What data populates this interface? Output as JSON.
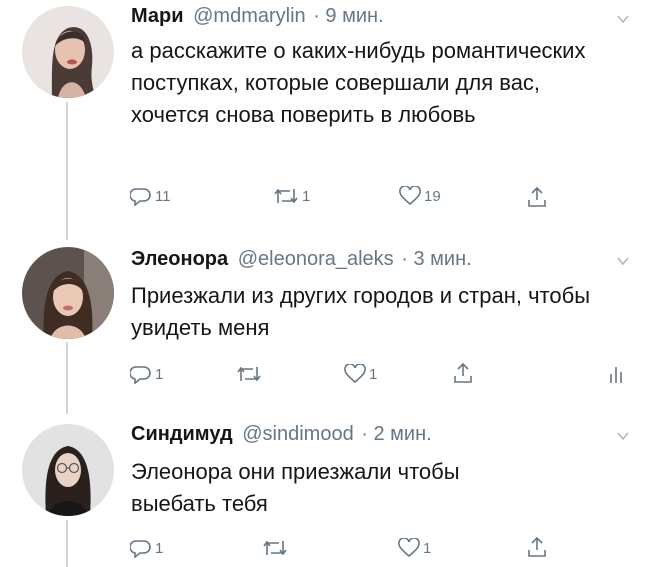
{
  "tweets": [
    {
      "name": "Мари",
      "handle": "@mdmarylin",
      "time": "· 9 мин.",
      "text": "а расскажите о каких-нибудь романтических поступках, которые совершали для вас, хочется снова поверить в любовь",
      "replies": "11",
      "retweets": "1",
      "likes": "19"
    },
    {
      "name": "Элеонора",
      "handle": "@eleonora_aleks",
      "time": "· 3 мин.",
      "text": "Приезжали из других городов и стран, чтобы увидеть меня",
      "replies": "1",
      "retweets": "",
      "likes": "1"
    },
    {
      "name": "Синдимуд",
      "handle": "@sindimood",
      "time": "· 2 мин.",
      "text": "Элеонора они приезжали чтобы выебать тебя",
      "replies": "1",
      "retweets": "",
      "likes": "1"
    }
  ],
  "icons": {
    "reply": "reply-icon",
    "retweet": "retweet-icon",
    "like": "heart-icon",
    "share": "share-icon",
    "analytics": "analytics-icon",
    "more": "chevron-down-icon"
  },
  "colors": {
    "secondary_text": "#657786",
    "thread_line": "#ccd6dd"
  }
}
